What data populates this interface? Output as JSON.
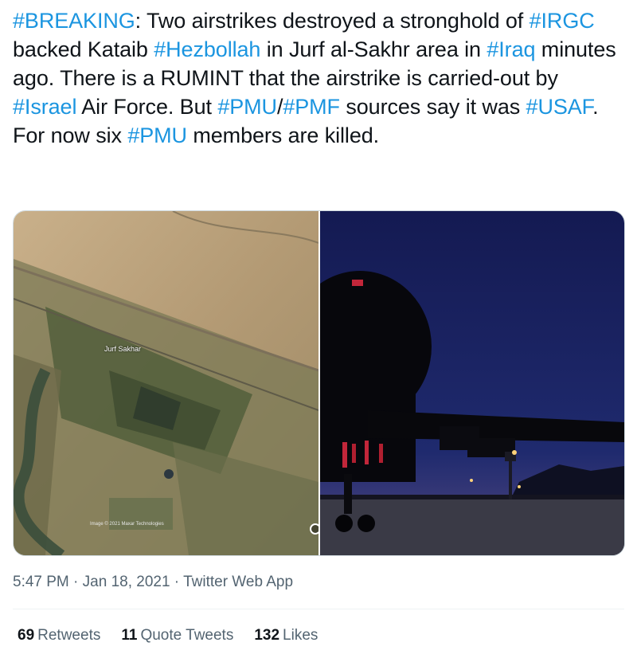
{
  "tweet": {
    "segments": [
      {
        "text": "#BREAKING",
        "tag": true
      },
      {
        "text": ": Two airstrikes destroyed a stronghold of ",
        "tag": false
      },
      {
        "text": "#IRGC",
        "tag": true
      },
      {
        "text": " backed Kataib ",
        "tag": false
      },
      {
        "text": "#Hezbollah",
        "tag": true
      },
      {
        "text": " in Jurf al-Sakhr area in ",
        "tag": false
      },
      {
        "text": "#Iraq",
        "tag": true
      },
      {
        "text": " minutes ago. There is a RUMINT that the airstrike is carried-out by ",
        "tag": false
      },
      {
        "text": "#Israel",
        "tag": true
      },
      {
        "text": " Air Force. But ",
        "tag": false
      },
      {
        "text": "#PMU",
        "tag": true
      },
      {
        "text": "/",
        "tag": false
      },
      {
        "text": "#PMF",
        "tag": true
      },
      {
        "text": " sources say it was ",
        "tag": false
      },
      {
        "text": "#USAF",
        "tag": true
      },
      {
        "text": ". For now six ",
        "tag": false
      },
      {
        "text": "#PMU",
        "tag": true
      },
      {
        "text": " members are killed.",
        "tag": false
      }
    ]
  },
  "media": {
    "left": {
      "label": "Jurf Sakhar",
      "copyright": "Image © 2021 Maxar Technologies"
    }
  },
  "meta": {
    "time": "5:47 PM",
    "sep1": " · ",
    "date": "Jan 18, 2021",
    "sep2": " · ",
    "app": "Twitter Web App"
  },
  "stats": {
    "retweets_count": "69",
    "retweets_label": "Retweets",
    "quotes_count": "11",
    "quotes_label": "Quote Tweets",
    "likes_count": "132",
    "likes_label": "Likes"
  },
  "colors": {
    "hashtag": "#1b95e0",
    "text": "#0f1419",
    "muted": "#536471"
  }
}
